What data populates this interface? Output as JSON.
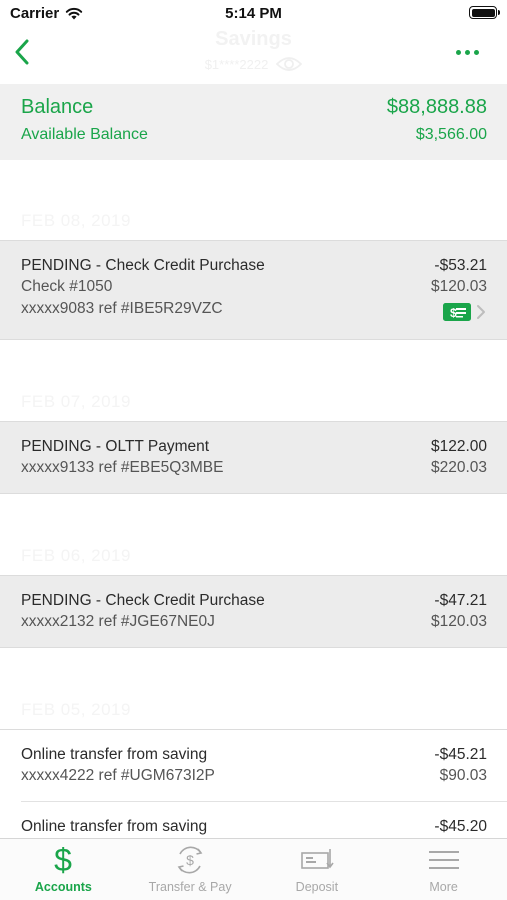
{
  "status_bar": {
    "carrier": "Carrier",
    "time": "5:14 PM"
  },
  "nav": {
    "title": "Savings",
    "account_mask": "$1****2222",
    "back_icon": "chevron-left-icon",
    "more_icon": "more-dots-icon"
  },
  "balance": {
    "label": "Balance",
    "value": "$88,888.88",
    "available_label": "Available Balance",
    "available_value": "$3,566.00"
  },
  "groups": [
    {
      "date": "FEB 08, 2019",
      "transactions": [
        {
          "title": "PENDING - Check Credit Purchase",
          "line2": "Check #1050",
          "line3": "xxxxx9083 ref #IBE5R29VZC",
          "amount": "-$53.21",
          "balance": "$120.03"
        }
      ]
    },
    {
      "date": "FEB 07, 2019",
      "transactions": [
        {
          "title": "PENDING - OLTT Payment",
          "line2": "xxxxx9133 ref #EBE5Q3MBE",
          "amount": "$122.00",
          "balance": "$220.03"
        }
      ]
    },
    {
      "date": "FEB 06, 2019",
      "transactions": [
        {
          "title": "PENDING - Check Credit Purchase",
          "line2": "xxxxx2132 ref #JGE67NE0J",
          "amount": "-$47.21",
          "balance": "$120.03"
        }
      ]
    },
    {
      "date": "FEB 05, 2019",
      "transactions": [
        {
          "title": "Online transfer from saving",
          "line2": "xxxxx4222 ref #UGM673I2P",
          "amount": "-$45.21",
          "balance": "$90.03"
        },
        {
          "title": "Online transfer from saving",
          "amount": "-$45.20"
        }
      ]
    }
  ],
  "tabs": [
    {
      "label": "Accounts",
      "icon": "dollar-icon",
      "active": true
    },
    {
      "label": "Transfer & Pay",
      "icon": "transfer-icon",
      "active": false
    },
    {
      "label": "Deposit",
      "icon": "check-deposit-icon",
      "active": false
    },
    {
      "label": "More",
      "icon": "menu-icon",
      "active": false
    }
  ],
  "colors": {
    "accent": "#1aa54a",
    "pending_bg": "#ececec",
    "card_bg": "#f0f0f0"
  }
}
